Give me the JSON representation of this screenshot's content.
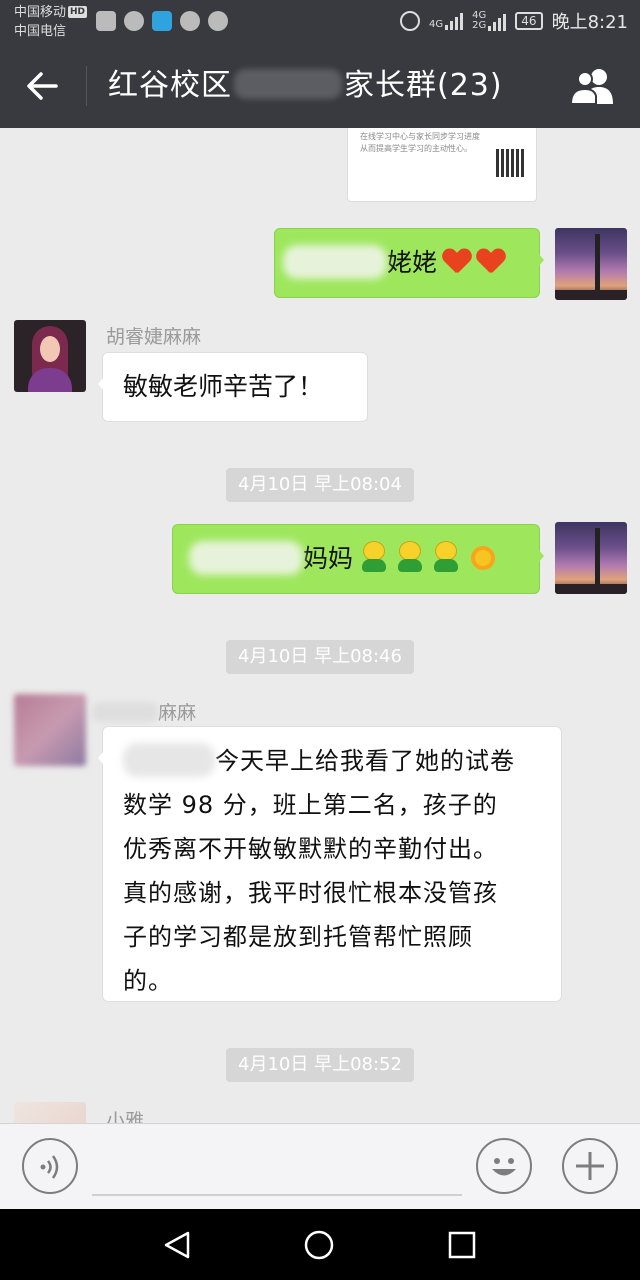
{
  "status_bar": {
    "carrier_1": "中国移动",
    "carrier_1_badge": "HD",
    "carrier_2": "中国电信",
    "network_1": "4G",
    "network_2": "4G",
    "network_3": "2G",
    "battery": "46",
    "time": "晚上8:21"
  },
  "header": {
    "title_prefix": "红谷校区",
    "title_suffix": "家长群(23)",
    "back_icon": "arrow-left-icon",
    "members_icon": "group-icon"
  },
  "chat": {
    "shared_card": {
      "line_1": "在线学习中心与家长同步学习进度",
      "line_2": "从而提高学生学习的主动性心。"
    },
    "msg_1": {
      "text": "姥姥",
      "emoji": [
        "heart",
        "heart"
      ]
    },
    "msg_2": {
      "sender": "胡睿婕麻麻",
      "text": "敏敏老师辛苦了！"
    },
    "time_1": "4月10日 早上08:04",
    "msg_3": {
      "text": "妈妈",
      "emoji": [
        "smiley",
        "smiley",
        "smiley",
        "sun"
      ]
    },
    "time_2": "4月10日 早上08:46",
    "msg_4": {
      "sender_suffix": "麻麻",
      "line_1": "今天早上给我看了她的试卷",
      "line_2": "数学 98 分，班上第二名，孩子的",
      "line_3": "优秀离不开敏敏默默的辛勤付出。",
      "line_4": "真的感谢，我平时很忙根本没管孩",
      "line_5": "子的学习都是放到托管帮忙照顾",
      "line_6": "的。"
    },
    "time_3": "4月10日 早上08:52",
    "msg_5": {
      "sender": "小雅"
    }
  },
  "input_bar": {
    "voice_icon": "voice-icon",
    "emoji_icon": "emoji-icon",
    "plus_icon": "plus-icon"
  },
  "nav_bar": {
    "back_icon": "nav-back-icon",
    "home_icon": "nav-home-icon",
    "recents_icon": "nav-recents-icon"
  }
}
